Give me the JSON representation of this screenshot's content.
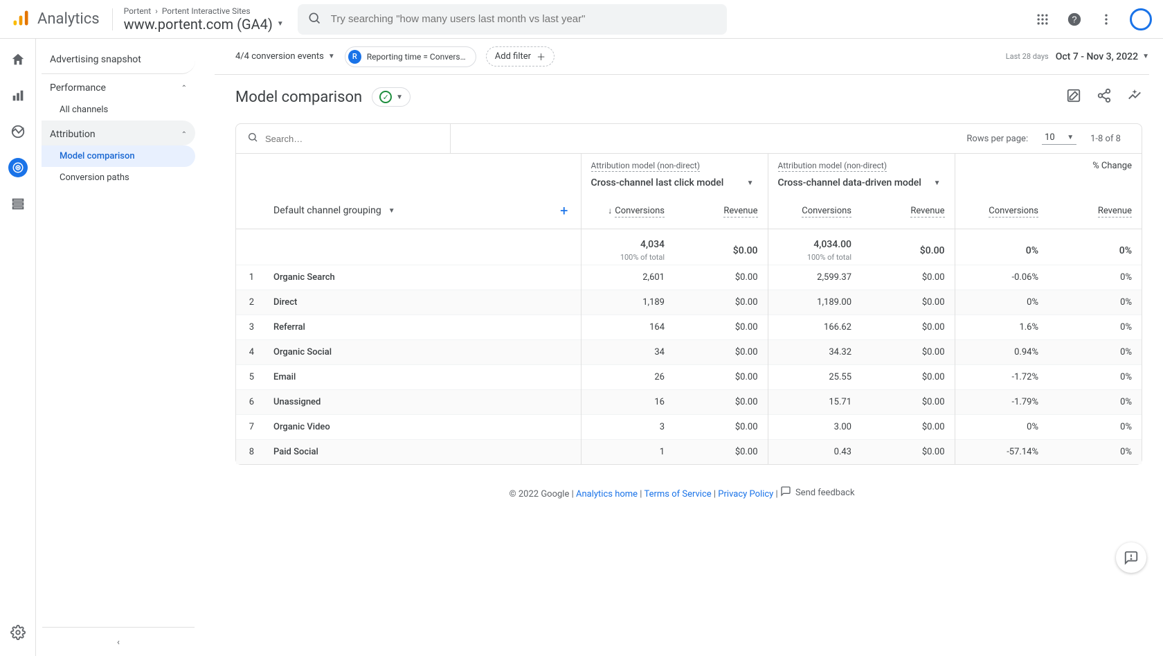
{
  "header": {
    "product": "Analytics",
    "breadcrumb": {
      "account": "Portent",
      "property": "Portent Interactive Sites"
    },
    "property_name": "www.portent.com (GA4)",
    "search_placeholder": "Try searching \"how many users last month vs last year\""
  },
  "sidebar": {
    "snapshot": "Advertising snapshot",
    "performance": {
      "label": "Performance",
      "items": [
        "All channels"
      ]
    },
    "attribution": {
      "label": "Attribution",
      "items": [
        "Model comparison",
        "Conversion paths"
      ],
      "active_index": 0
    }
  },
  "toolbar": {
    "conv_events": "4/4 conversion events",
    "reporting_chip": "Reporting time = Conversio…",
    "chip_badge": "R",
    "add_filter": "Add filter",
    "date_label": "Last 28 days",
    "date_range": "Oct 7 - Nov 3, 2022"
  },
  "page": {
    "title": "Model comparison"
  },
  "table": {
    "search_placeholder": "Search…",
    "rows_label": "Rows per page:",
    "rows_value": "10",
    "range": "1-8 of 8",
    "model_label": "Attribution model (non-direct)",
    "model_a": "Cross-channel last click model",
    "model_b": "Cross-channel data-driven model",
    "change_label": "% Change",
    "dim_label": "Default channel grouping",
    "metric_conv": "Conversions",
    "metric_rev": "Revenue",
    "totals": {
      "conv_a": "4,034",
      "conv_a_sub": "100% of total",
      "rev_a": "$0.00",
      "conv_b": "4,034.00",
      "conv_b_sub": "100% of total",
      "rev_b": "$0.00",
      "chg_conv": "0%",
      "chg_rev": "0%"
    },
    "rows": [
      {
        "idx": "1",
        "dim": "Organic Search",
        "ca": "2,601",
        "ra": "$0.00",
        "cb": "2,599.37",
        "rb": "$0.00",
        "cc": "-0.06%",
        "cr": "0%"
      },
      {
        "idx": "2",
        "dim": "Direct",
        "ca": "1,189",
        "ra": "$0.00",
        "cb": "1,189.00",
        "rb": "$0.00",
        "cc": "0%",
        "cr": "0%"
      },
      {
        "idx": "3",
        "dim": "Referral",
        "ca": "164",
        "ra": "$0.00",
        "cb": "166.62",
        "rb": "$0.00",
        "cc": "1.6%",
        "cr": "0%"
      },
      {
        "idx": "4",
        "dim": "Organic Social",
        "ca": "34",
        "ra": "$0.00",
        "cb": "34.32",
        "rb": "$0.00",
        "cc": "0.94%",
        "cr": "0%"
      },
      {
        "idx": "5",
        "dim": "Email",
        "ca": "26",
        "ra": "$0.00",
        "cb": "25.55",
        "rb": "$0.00",
        "cc": "-1.72%",
        "cr": "0%"
      },
      {
        "idx": "6",
        "dim": "Unassigned",
        "ca": "16",
        "ra": "$0.00",
        "cb": "15.71",
        "rb": "$0.00",
        "cc": "-1.79%",
        "cr": "0%"
      },
      {
        "idx": "7",
        "dim": "Organic Video",
        "ca": "3",
        "ra": "$0.00",
        "cb": "3.00",
        "rb": "$0.00",
        "cc": "0%",
        "cr": "0%"
      },
      {
        "idx": "8",
        "dim": "Paid Social",
        "ca": "1",
        "ra": "$0.00",
        "cb": "0.43",
        "rb": "$0.00",
        "cc": "-57.14%",
        "cr": "0%"
      }
    ]
  },
  "footer": {
    "copyright": "© 2022 Google",
    "links": {
      "home": "Analytics home",
      "terms": "Terms of Service",
      "privacy": "Privacy Policy"
    },
    "feedback": "Send feedback"
  }
}
